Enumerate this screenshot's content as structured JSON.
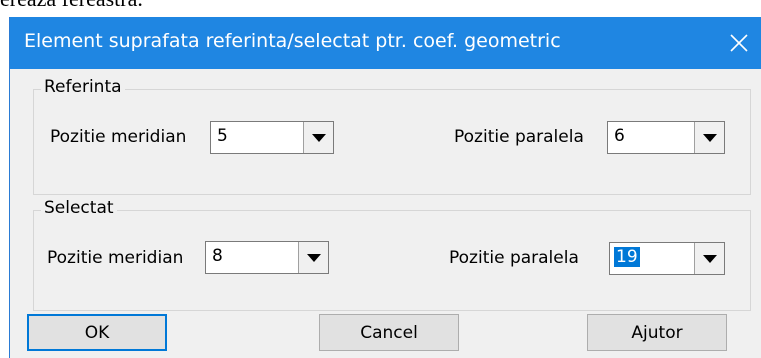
{
  "page_text": "ereaza fereastra.",
  "dialog": {
    "title": "Element suprafata referinta/selectat ptr. coef. geometric",
    "close_icon": "close-icon"
  },
  "referinta": {
    "label": "Referinta",
    "meridian_label": "Pozitie meridian",
    "meridian_value": "5",
    "paralela_label": "Pozitie paralela",
    "paralela_value": "6"
  },
  "selectat": {
    "label": "Selectat",
    "meridian_label": "Pozitie meridian",
    "meridian_value": "8",
    "paralela_label": "Pozitie paralela",
    "paralela_value": "19"
  },
  "buttons": {
    "ok": "OK",
    "cancel": "Cancel",
    "help": "Ajutor"
  },
  "colors": {
    "titlebar": "#1f86e2",
    "selection": "#0078d7"
  }
}
